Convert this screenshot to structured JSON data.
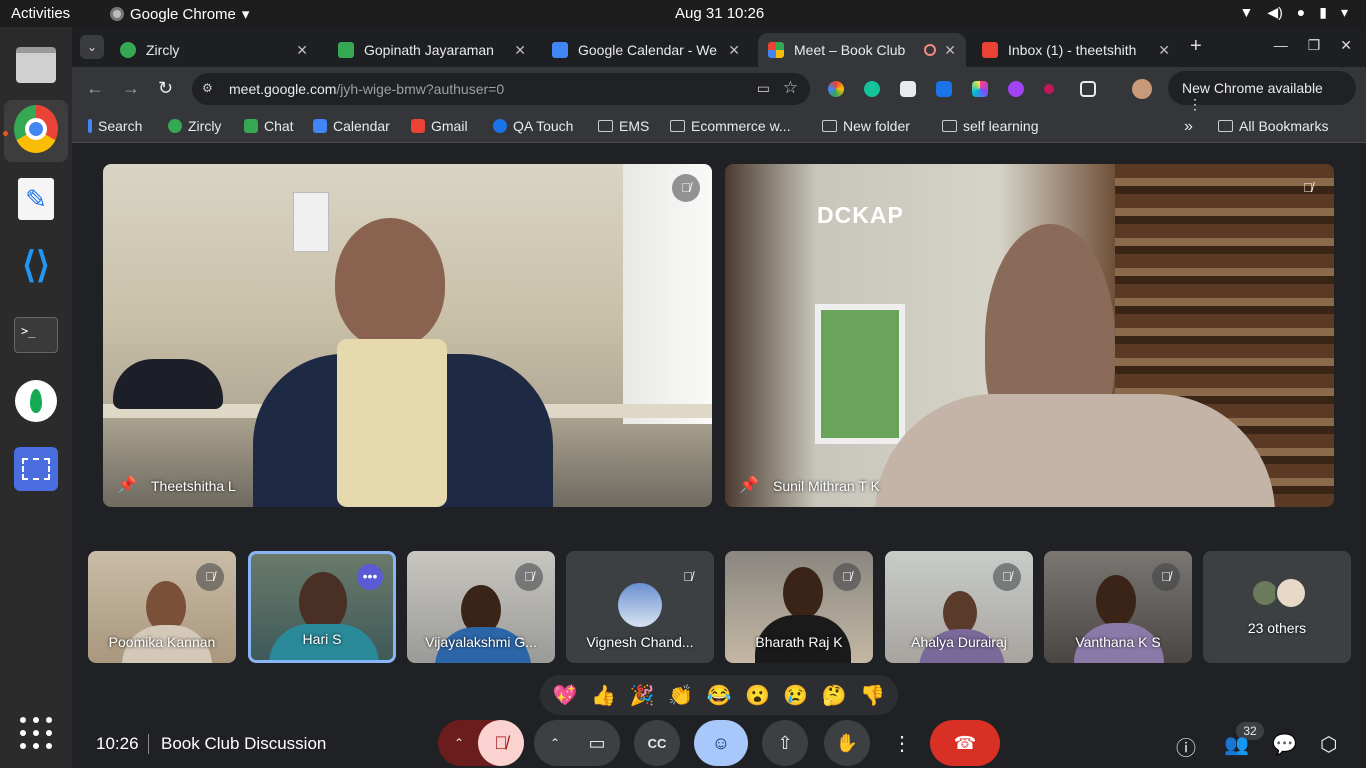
{
  "os": {
    "activities": "Activities",
    "app_name": "Google Chrome",
    "datetime": "Aug 31  10:26"
  },
  "tabs": [
    {
      "label": "Zircly",
      "color": "#34a853"
    },
    {
      "label": "Gopinath Jayaraman",
      "color": "#4285f4"
    },
    {
      "label": "Google Calendar - We",
      "color": "#4285f4"
    },
    {
      "label": "Meet – Book Club",
      "color": "#fbbc04"
    },
    {
      "label": "Inbox (1) - theetshith",
      "color": "#ea4335"
    }
  ],
  "toolbar": {
    "url_host": "meet.google.com",
    "url_path": "/jyh-wige-bmw?authuser=0",
    "new_chrome": "New Chrome available"
  },
  "bookmarks": [
    {
      "label": "Search",
      "kind": "icon",
      "color": "#4285f4"
    },
    {
      "label": "Zircly",
      "kind": "icon",
      "color": "#34a853"
    },
    {
      "label": "Chat",
      "kind": "icon",
      "color": "#34a853"
    },
    {
      "label": "Calendar",
      "kind": "icon",
      "color": "#4285f4"
    },
    {
      "label": "Gmail",
      "kind": "icon",
      "color": "#ea4335"
    },
    {
      "label": "QA Touch",
      "kind": "icon",
      "color": "#1a73e8"
    },
    {
      "label": "EMS",
      "kind": "folder"
    },
    {
      "label": "Ecommerce w...",
      "kind": "folder"
    },
    {
      "label": "New folder",
      "kind": "folder"
    },
    {
      "label": "self learning",
      "kind": "folder"
    }
  ],
  "all_bookmarks": "All Bookmarks",
  "meet": {
    "main": [
      {
        "name": "Theetshitha L"
      },
      {
        "name": "Sunil Mithran T K",
        "logo": "DCKAP"
      }
    ],
    "strip": [
      {
        "name": "Poomika Kannan"
      },
      {
        "name": "Hari S"
      },
      {
        "name": "Vijayalakshmi G..."
      },
      {
        "name": "Vignesh Chand..."
      },
      {
        "name": "Bharath Raj K"
      },
      {
        "name": "Ahalya Durairaj"
      },
      {
        "name": "Vanthana K S"
      }
    ],
    "others": "23 others",
    "reactions": [
      "💖",
      "👍",
      "🎉",
      "👏",
      "😂",
      "😮",
      "😢",
      "🤔",
      "👎"
    ],
    "time": "10:26",
    "meeting_title": "Book Club Discussion",
    "participant_count": "32"
  }
}
